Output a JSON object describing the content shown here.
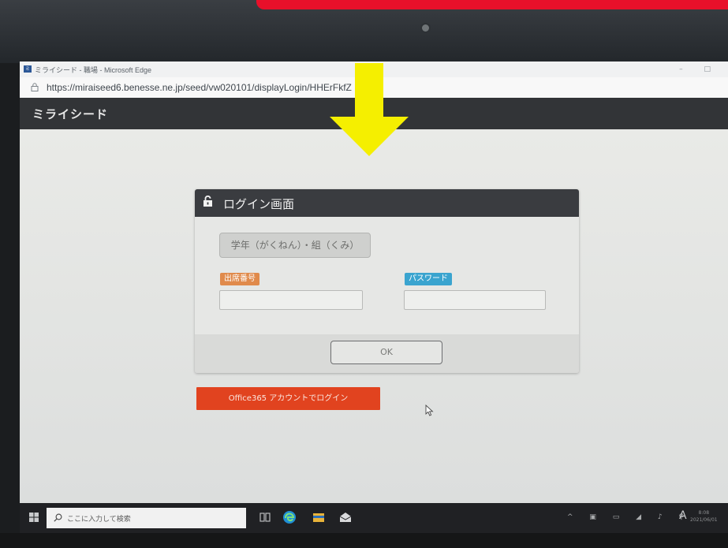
{
  "browser": {
    "window_title": "ミライシード - 職場 - Microsoft Edge",
    "url": "https://miraiseed6.benesse.ne.jp/seed/vw020101/displayLogin/HHErFkfZ",
    "window_controls": "–  □"
  },
  "app": {
    "logo": "ミライシード"
  },
  "login": {
    "title": "ログイン画面",
    "class_select_label": "学年（がくねん）・組（くみ）",
    "student_number_label": "出席番号",
    "password_label": "パスワード",
    "ok_label": "OK",
    "office365_label": "Office365 アカウントでログイン"
  },
  "taskbar": {
    "search_placeholder": "ここに入力して検索",
    "tray_language": "A",
    "clock_time": "8:08",
    "clock_date": "2021/06/01"
  },
  "colors": {
    "office365_button": "#e1431f",
    "student_number_tag": "#e08a4b",
    "password_tag": "#3aa4cf",
    "annotation_arrow": "#f5ef00",
    "annotation_banner": "#e8102a"
  },
  "icons": [
    "unlock-icon",
    "lock-icon",
    "windows-icon",
    "search-icon",
    "edge-icon",
    "file-explorer-icon",
    "mail-icon",
    "cursor-icon",
    "down-arrow-icon"
  ]
}
